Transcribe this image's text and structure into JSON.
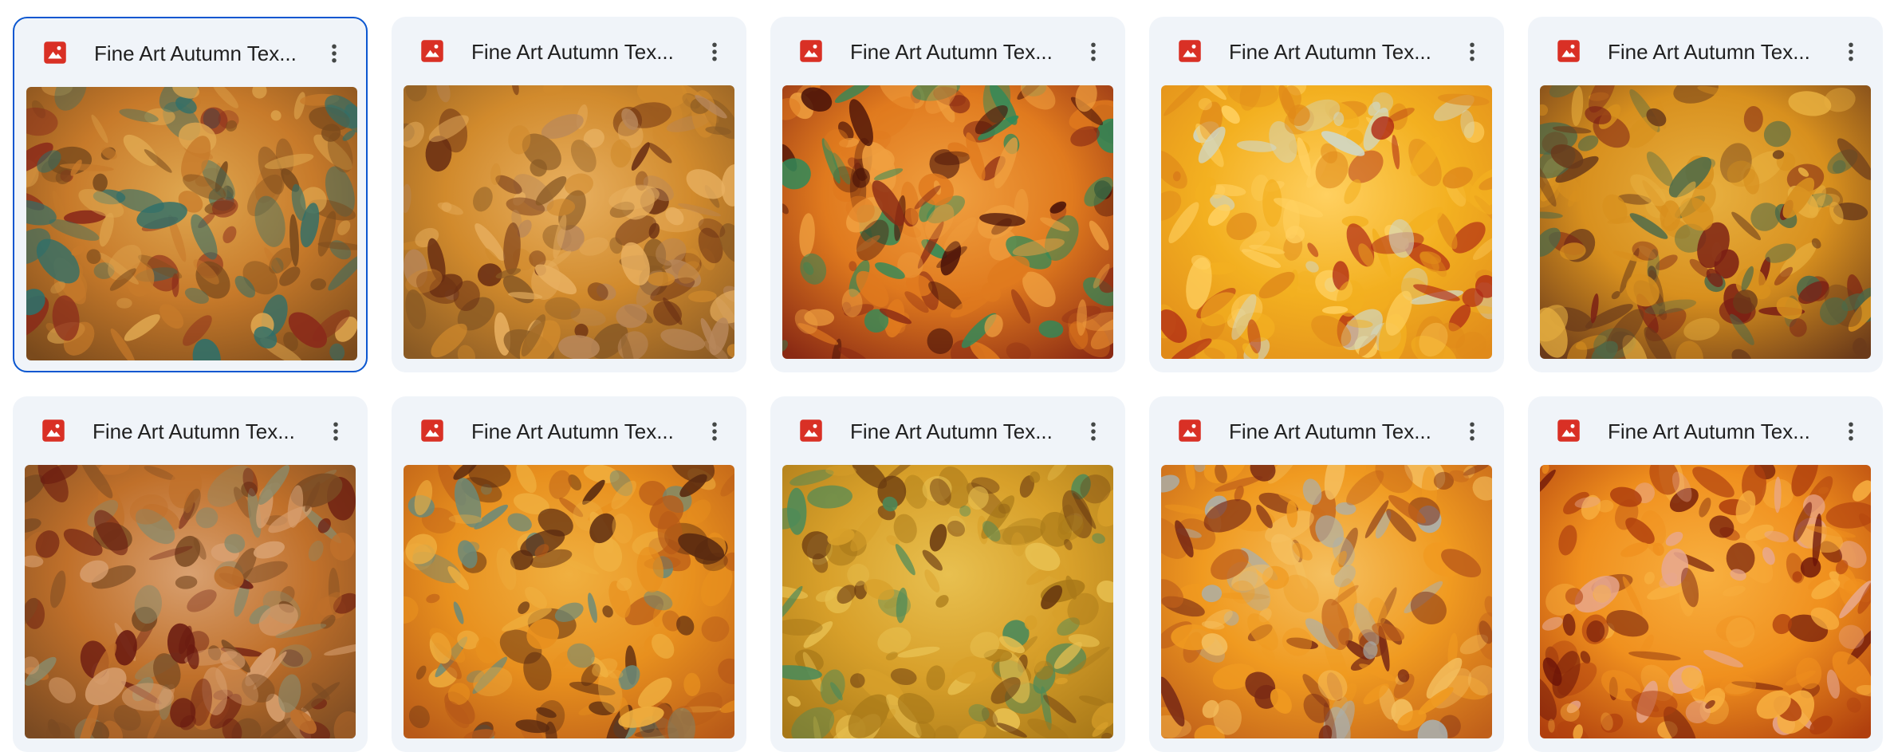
{
  "files": [
    {
      "name": "Fine Art Autumn Tex...",
      "selected": true,
      "palette": {
        "base": "#7a4a1c",
        "c1": "#2e6f6a",
        "c2": "#c77a2a",
        "c3": "#8a2a1a",
        "c4": "#e0a850"
      }
    },
    {
      "name": "Fine Art Autumn Tex...",
      "selected": false,
      "palette": {
        "base": "#8a5a24",
        "c1": "#b8875a",
        "c2": "#d18a2c",
        "c3": "#6a2e12",
        "c4": "#e8b060"
      }
    },
    {
      "name": "Fine Art Autumn Tex...",
      "selected": false,
      "palette": {
        "base": "#8a2a14",
        "c1": "#2f8a5a",
        "c2": "#e07a1e",
        "c3": "#4a1208",
        "c4": "#f0a040"
      }
    },
    {
      "name": "Fine Art Autumn Tex...",
      "selected": false,
      "palette": {
        "base": "#e08a1a",
        "c1": "#cfd8c8",
        "c2": "#f3b020",
        "c3": "#b02a14",
        "c4": "#ffd060"
      }
    },
    {
      "name": "Fine Art Autumn Tex...",
      "selected": false,
      "palette": {
        "base": "#6a3a1a",
        "c1": "#4a6a4a",
        "c2": "#d8901e",
        "c3": "#7a1e14",
        "c4": "#e8b040"
      }
    },
    {
      "name": "Fine Art Autumn Tex...",
      "selected": false,
      "palette": {
        "base": "#7a4a22",
        "c1": "#8a8a6a",
        "c2": "#c0702a",
        "c3": "#6a1a10",
        "c4": "#d8a070"
      }
    },
    {
      "name": "Fine Art Autumn Tex...",
      "selected": false,
      "palette": {
        "base": "#b85a18",
        "c1": "#6a8a7a",
        "c2": "#e8901e",
        "c3": "#5a2a10",
        "c4": "#f0b040"
      }
    },
    {
      "name": "Fine Art Autumn Tex...",
      "selected": false,
      "palette": {
        "base": "#a87818",
        "c1": "#4a8a5a",
        "c2": "#d8a02a",
        "c3": "#6a3a10",
        "c4": "#e8c050"
      }
    },
    {
      "name": "Fine Art Autumn Tex...",
      "selected": false,
      "palette": {
        "base": "#c0601a",
        "c1": "#a8b0b0",
        "c2": "#f09a20",
        "c3": "#7a2a14",
        "c4": "#f5c060"
      }
    },
    {
      "name": "Fine Art Autumn Tex...",
      "selected": false,
      "palette": {
        "base": "#b0400e",
        "c1": "#e8a890",
        "c2": "#f0901e",
        "c3": "#6a1208",
        "c4": "#f8b040"
      }
    }
  ],
  "icons": {
    "file_type": "image-file-icon",
    "more": "more-vertical-icon"
  },
  "colors": {
    "file_icon": "#d93025",
    "selected_border": "#0b57d0",
    "card_bg": "#f0f4f9"
  }
}
